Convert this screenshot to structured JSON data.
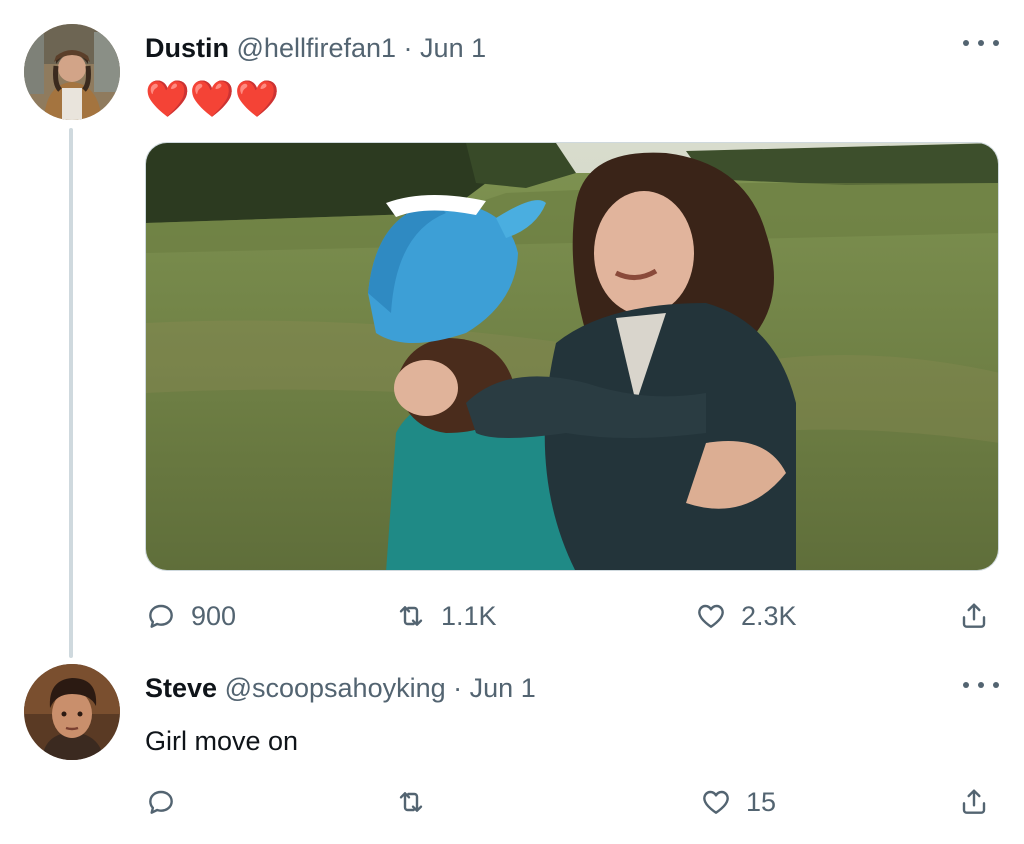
{
  "tweet1": {
    "name": "Dustin",
    "handle": "@hellfirefan1",
    "separator": "·",
    "date": "Jun 1",
    "body": "❤️❤️❤️",
    "replies": "900",
    "retweets": "1.1K",
    "likes": "2.3K",
    "avatar_icon": "dustin-avatar-photo",
    "media_icon": "photo-two-people-hugging-in-field"
  },
  "tweet2": {
    "name": "Steve",
    "handle": "@scoopsahoyking",
    "separator": "·",
    "date": "Jun 1",
    "body": "Girl move on",
    "replies": "",
    "retweets": "",
    "likes": "15",
    "avatar_icon": "steve-avatar-photo"
  },
  "colors": {
    "text": "#0f1419",
    "secondary": "#536471",
    "border": "#cfd9de",
    "heart": "#e0245e"
  }
}
